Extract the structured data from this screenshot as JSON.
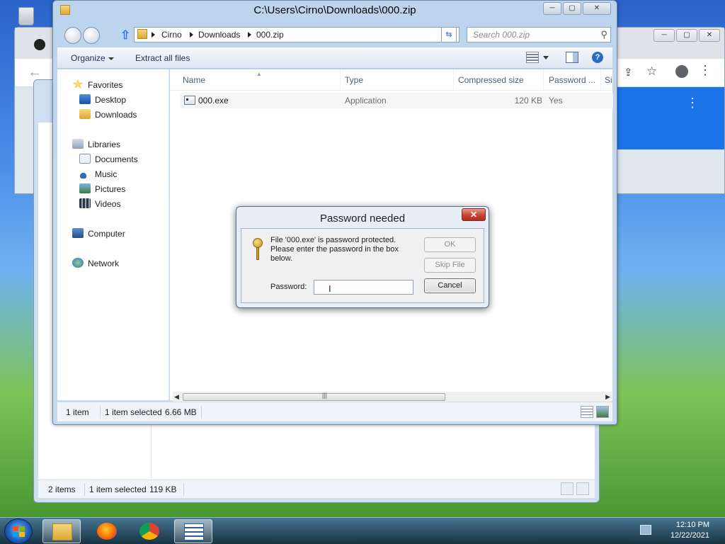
{
  "explorer": {
    "title": "C:\\Users\\Cirno\\Downloads\\000.zip",
    "window_controls": [
      "─",
      "▢",
      "✕"
    ],
    "breadcrumb": [
      "Cirno",
      "Downloads",
      "000.zip"
    ],
    "search_placeholder": "Search 000.zip",
    "toolbar": {
      "organize": "Organize",
      "extract": "Extract all files"
    },
    "nav": {
      "favorites": "Favorites",
      "desktop": "Desktop",
      "downloads": "Downloads",
      "libraries": "Libraries",
      "documents": "Documents",
      "music": "Music",
      "pictures": "Pictures",
      "videos": "Videos",
      "computer": "Computer",
      "network": "Network"
    },
    "columns": {
      "name": "Name",
      "type": "Type",
      "compressed": "Compressed size",
      "password": "Password ...",
      "size": "Si"
    },
    "files": [
      {
        "name": "000.exe",
        "type": "Application",
        "compressed": "120 KB",
        "password": "Yes"
      }
    ],
    "status": {
      "count": "1 item",
      "selected": "1 item selected",
      "size": "6.66 MB"
    }
  },
  "explorer2": {
    "status": {
      "count": "2 items",
      "selected": "1 item selected",
      "size": "119 KB"
    }
  },
  "dialog": {
    "title": "Password needed",
    "close_glyph": "✕",
    "message": "File '000.exe' is password protected. Please enter the password in the box below.",
    "password_label": "Password:",
    "password_value": "",
    "ok": "OK",
    "skip": "Skip File",
    "cancel": "Cancel"
  },
  "taskbar": {
    "time": "12:10 PM",
    "date": "12/22/2021",
    "apps": [
      "windows-explorer",
      "firefox",
      "chrome",
      "task-list"
    ]
  },
  "colors": {
    "accent": "#1a73e8",
    "dialog_close": "#c9432f",
    "window_frame": "#bcd4ee"
  }
}
